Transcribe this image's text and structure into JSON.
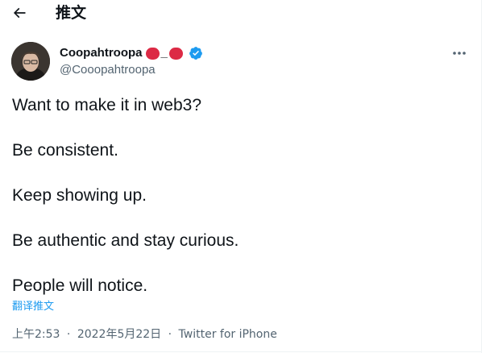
{
  "header": {
    "title": "推文",
    "back_icon": "arrow-left-icon"
  },
  "author": {
    "display_name": "Coopahtroopa",
    "name_separator": "_",
    "handle": "@Cooopahtroopa",
    "verified": true,
    "badge_color": "#dc2a45",
    "verified_color": "#1d9bf0"
  },
  "more_icon": "more-horizontal-icon",
  "tweet": {
    "lines": [
      "Want to make it in web3?",
      "Be consistent.",
      "Keep showing up.",
      "Be authentic and stay curious.",
      "People will notice."
    ]
  },
  "translate_label": "翻译推文",
  "meta": {
    "time": "上午2:53",
    "date": "2022年5月22日",
    "separator": "·",
    "source": "Twitter for iPhone"
  }
}
